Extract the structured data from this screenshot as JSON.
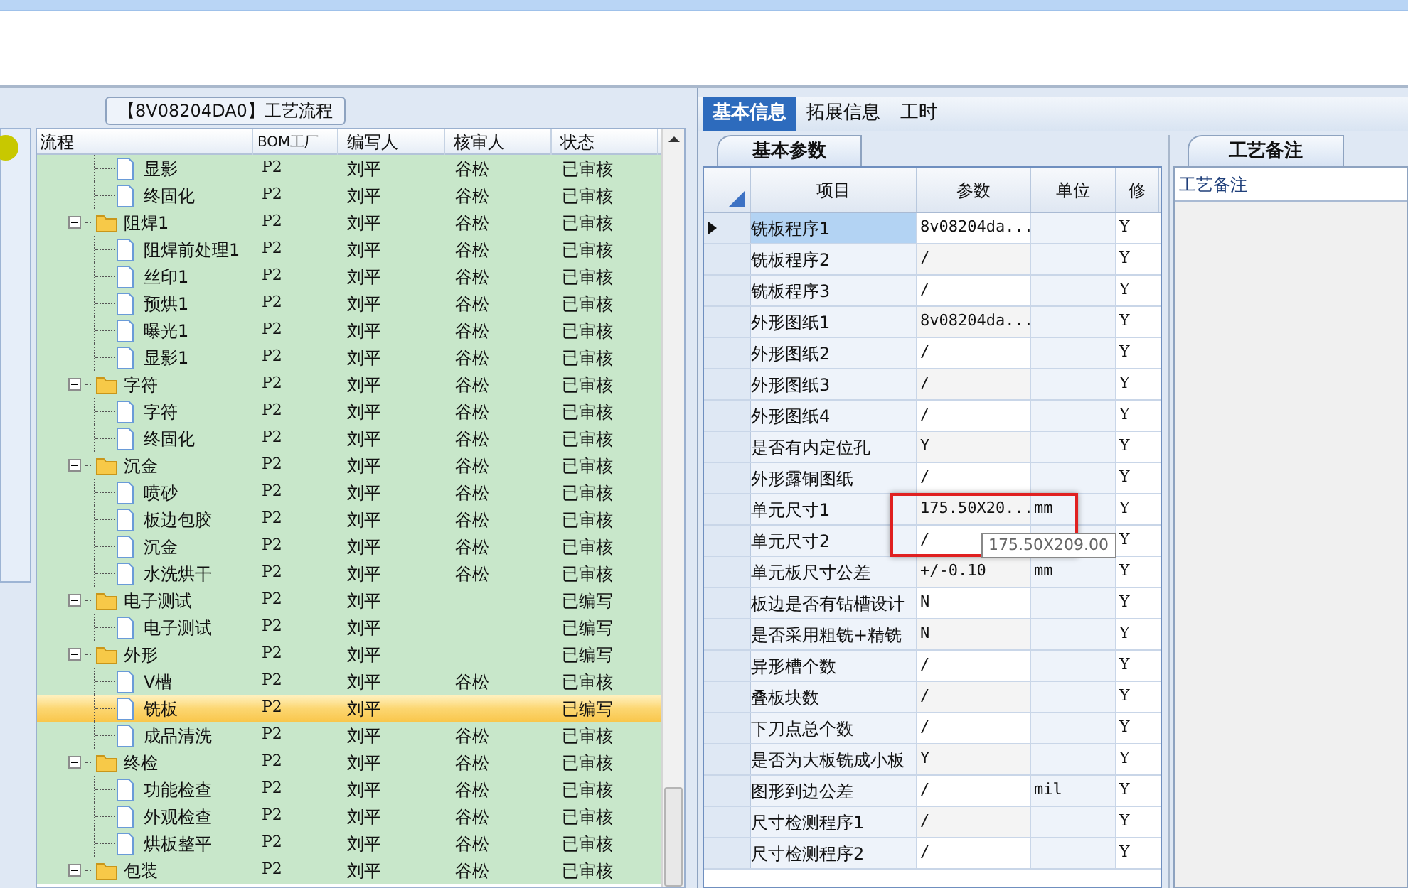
{
  "process_panel": {
    "title": "【8V08204DA0】工艺流程",
    "columns": [
      "流程",
      "BOM工厂",
      "编写人",
      "核审人",
      "状态"
    ],
    "tree": [
      {
        "kind": "folder",
        "children": [
          {
            "kind": "step",
            "label": "显影",
            "bom": "P2",
            "author": "刘平",
            "reviewer": "谷松",
            "status": "已审核",
            "selected": false
          },
          {
            "kind": "step",
            "label": "终固化",
            "bom": "P2",
            "author": "刘平",
            "reviewer": "谷松",
            "status": "已审核",
            "selected": false
          }
        ]
      },
      {
        "kind": "folder",
        "label": "阻焊1",
        "bom": "P2",
        "author": "刘平",
        "reviewer": "谷松",
        "status": "已审核",
        "selected": false,
        "expanded": true,
        "children": [
          {
            "kind": "step",
            "label": "阻焊前处理1",
            "bom": "P2",
            "author": "刘平",
            "reviewer": "谷松",
            "status": "已审核",
            "selected": false
          },
          {
            "kind": "step",
            "label": "丝印1",
            "bom": "P2",
            "author": "刘平",
            "reviewer": "谷松",
            "status": "已审核",
            "selected": false
          },
          {
            "kind": "step",
            "label": "预烘1",
            "bom": "P2",
            "author": "刘平",
            "reviewer": "谷松",
            "status": "已审核",
            "selected": false
          },
          {
            "kind": "step",
            "label": "曝光1",
            "bom": "P2",
            "author": "刘平",
            "reviewer": "谷松",
            "status": "已审核",
            "selected": false
          },
          {
            "kind": "step",
            "label": "显影1",
            "bom": "P2",
            "author": "刘平",
            "reviewer": "谷松",
            "status": "已审核",
            "selected": false
          }
        ]
      },
      {
        "kind": "folder",
        "label": "字符",
        "bom": "P2",
        "author": "刘平",
        "reviewer": "谷松",
        "status": "已审核",
        "selected": false,
        "expanded": true,
        "children": [
          {
            "kind": "step",
            "label": "字符",
            "bom": "P2",
            "author": "刘平",
            "reviewer": "谷松",
            "status": "已审核",
            "selected": false
          },
          {
            "kind": "step",
            "label": "终固化",
            "bom": "P2",
            "author": "刘平",
            "reviewer": "谷松",
            "status": "已审核",
            "selected": false
          }
        ]
      },
      {
        "kind": "folder",
        "label": "沉金",
        "bom": "P2",
        "author": "刘平",
        "reviewer": "谷松",
        "status": "已审核",
        "selected": false,
        "expanded": true,
        "children": [
          {
            "kind": "step",
            "label": "喷砂",
            "bom": "P2",
            "author": "刘平",
            "reviewer": "谷松",
            "status": "已审核",
            "selected": false
          },
          {
            "kind": "step",
            "label": "板边包胶",
            "bom": "P2",
            "author": "刘平",
            "reviewer": "谷松",
            "status": "已审核",
            "selected": false
          },
          {
            "kind": "step",
            "label": "沉金",
            "bom": "P2",
            "author": "刘平",
            "reviewer": "谷松",
            "status": "已审核",
            "selected": false
          },
          {
            "kind": "step",
            "label": "水洗烘干",
            "bom": "P2",
            "author": "刘平",
            "reviewer": "谷松",
            "status": "已审核",
            "selected": false
          }
        ]
      },
      {
        "kind": "folder",
        "label": "电子测试",
        "bom": "P2",
        "author": "刘平",
        "status": "已编写",
        "selected": false,
        "expanded": true,
        "children": [
          {
            "kind": "step",
            "label": "电子测试",
            "bom": "P2",
            "author": "刘平",
            "status": "已编写",
            "selected": false
          }
        ]
      },
      {
        "kind": "folder",
        "label": "外形",
        "bom": "P2",
        "author": "刘平",
        "status": "已编写",
        "selected": false,
        "expanded": true,
        "children": [
          {
            "kind": "step",
            "label": "V槽",
            "bom": "P2",
            "author": "刘平",
            "reviewer": "谷松",
            "status": "已审核",
            "selected": false
          },
          {
            "kind": "step",
            "label": "铣板",
            "bom": "P2",
            "author": "刘平",
            "status": "已编写",
            "selected": true
          },
          {
            "kind": "step",
            "label": "成品清洗",
            "bom": "P2",
            "author": "刘平",
            "reviewer": "谷松",
            "status": "已审核",
            "selected": false
          }
        ]
      },
      {
        "kind": "folder",
        "label": "终检",
        "bom": "P2",
        "author": "刘平",
        "reviewer": "谷松",
        "status": "已审核",
        "selected": false,
        "expanded": true,
        "children": [
          {
            "kind": "step",
            "label": "功能检查",
            "bom": "P2",
            "author": "刘平",
            "reviewer": "谷松",
            "status": "已审核",
            "selected": false
          },
          {
            "kind": "step",
            "label": "外观检查",
            "bom": "P2",
            "author": "刘平",
            "reviewer": "谷松",
            "status": "已审核",
            "selected": false
          },
          {
            "kind": "step",
            "label": "烘板整平",
            "bom": "P2",
            "author": "刘平",
            "reviewer": "谷松",
            "status": "已审核",
            "selected": false
          }
        ]
      },
      {
        "kind": "folder",
        "label": "包装",
        "bom": "P2",
        "author": "刘平",
        "reviewer": "谷松",
        "status": "已审核",
        "selected": false,
        "expanded": true
      }
    ]
  },
  "detail_tabs": [
    {
      "label": "基本信息",
      "selected": true
    },
    {
      "label": "拓展信息",
      "selected": false
    },
    {
      "label": "工时",
      "selected": false
    }
  ],
  "params_panel": {
    "tab": "基本参数",
    "columns": [
      "项目",
      "参数",
      "单位",
      "修"
    ],
    "rows": [
      {
        "item": "铣板程序1",
        "value": "8v08204da...",
        "unit": "",
        "flag": "Y",
        "selected": true
      },
      {
        "item": "铣板程序2",
        "value": "/",
        "unit": "",
        "flag": "Y",
        "selected": false
      },
      {
        "item": "铣板程序3",
        "value": "/",
        "unit": "",
        "flag": "Y",
        "selected": false
      },
      {
        "item": "外形图纸1",
        "value": "8v08204da...",
        "unit": "",
        "flag": "Y",
        "selected": false
      },
      {
        "item": "外形图纸2",
        "value": "/",
        "unit": "",
        "flag": "Y",
        "selected": false
      },
      {
        "item": "外形图纸3",
        "value": "/",
        "unit": "",
        "flag": "Y",
        "selected": false
      },
      {
        "item": "外形图纸4",
        "value": "/",
        "unit": "",
        "flag": "Y",
        "selected": false
      },
      {
        "item": "是否有内定位孔",
        "value": "Y",
        "unit": "",
        "flag": "Y",
        "selected": false
      },
      {
        "item": "外形露铜图纸",
        "value": "/",
        "unit": "",
        "flag": "Y",
        "selected": false
      },
      {
        "item": "单元尺寸1",
        "value": "175.50X20...",
        "unit": "mm",
        "flag": "Y",
        "selected": false
      },
      {
        "item": "单元尺寸2",
        "value": "/",
        "unit": "",
        "flag": "Y",
        "selected": false
      },
      {
        "item": "单元板尺寸公差",
        "value": "+/-0.10",
        "unit": "mm",
        "flag": "Y",
        "selected": false
      },
      {
        "item": "板边是否有钻槽设计",
        "value": "N",
        "unit": "",
        "flag": "Y",
        "selected": false
      },
      {
        "item": "是否采用粗铣+精铣",
        "value": "N",
        "unit": "",
        "flag": "Y",
        "selected": false
      },
      {
        "item": "异形槽个数",
        "value": "/",
        "unit": "",
        "flag": "Y",
        "selected": false
      },
      {
        "item": "叠板块数",
        "value": "/",
        "unit": "",
        "flag": "Y",
        "selected": false
      },
      {
        "item": "下刀点总个数",
        "value": "/",
        "unit": "",
        "flag": "Y",
        "selected": false
      },
      {
        "item": "是否为大板铣成小板",
        "value": "Y",
        "unit": "",
        "flag": "Y",
        "selected": false
      },
      {
        "item": "图形到边公差",
        "value": "/",
        "unit": "mil",
        "flag": "Y",
        "selected": false
      },
      {
        "item": "尺寸检测程序1",
        "value": "/",
        "unit": "",
        "flag": "Y",
        "selected": false
      },
      {
        "item": "尺寸检测程序2",
        "value": "/",
        "unit": "",
        "flag": "Y",
        "selected": false
      }
    ],
    "tooltip": "175.50X209.00"
  },
  "notes_panel": {
    "tab": "工艺备注",
    "label": "工艺备注"
  }
}
